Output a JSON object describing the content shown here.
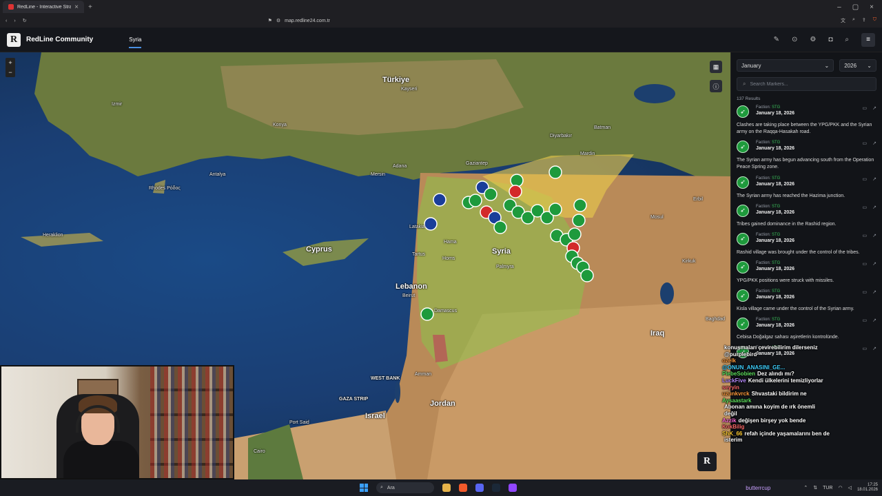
{
  "browser": {
    "tab_title": "RedLine - Interactive Strategic M",
    "url": "map.redline24.com.tr"
  },
  "header": {
    "logo_letter": "R",
    "brand": "RedLine Community",
    "nav_active": "Syria",
    "menu_icon": "hamburger-icon"
  },
  "map": {
    "zoom_in": "+",
    "zoom_out": "−",
    "labels": {
      "turkiye": "Türkiye",
      "syria": "Syria",
      "cyprus": "Cyprus",
      "lebanon": "Lebanon",
      "iraq": "Iraq",
      "jordan": "Jordan",
      "israel": "Israel",
      "west_bank": "WEST BANK",
      "gaza": "GAZA STRIP",
      "kayseri": "Kayseri",
      "adana": "Adana",
      "mersin": "Mersin",
      "gaziantep": "Gaziantep",
      "homs": "Homs",
      "hama": "Hama",
      "damascus": "Damascus",
      "beirut": "Beirut",
      "amman": "Amman",
      "baghdad": "Baghdad",
      "mosul": "Mosul",
      "erbil": "Erbil",
      "izmir": "Izmir",
      "konya": "Konya",
      "antalya": "Antalya",
      "rhodes": "Rhodes\nΡόδος",
      "heraklion": "Heraklion",
      "cairo": "Cairo",
      "port_said": "Port Said",
      "batman": "Batman",
      "mardin": "Mardin",
      "diyarbakir": "Diyarbakır",
      "palmyra": "Palmyra",
      "tartus": "Tartus",
      "latakia": "Latakia",
      "kirkuk": "Kirkuk"
    },
    "r_button": "R"
  },
  "sidebar": {
    "month": "January",
    "year": "2026",
    "search_placeholder": "Search Markers...",
    "results": "137 Results",
    "faction_label": "Faction:",
    "items": [
      {
        "faction": "STG",
        "date": "January 18, 2026",
        "text": "Clashes are taking place between the YPG/PKK and the Syrian army on the Raqqa-Hasakah road."
      },
      {
        "faction": "STG",
        "date": "January 18, 2026",
        "text": "The Syrian army has begun advancing south from the Operation Peace Spring zone."
      },
      {
        "faction": "STG",
        "date": "January 18, 2026",
        "text": "The Syrian army has reached the Hazima junction."
      },
      {
        "faction": "STG",
        "date": "January 18, 2026",
        "text": "Tribes gained dominance in the Rashid region."
      },
      {
        "faction": "STG",
        "date": "January 18, 2026",
        "text": "Rashid village was brought under the control of the tribes."
      },
      {
        "faction": "STG",
        "date": "January 18, 2026",
        "text": "YPG/PKK positions were struck with missiles."
      },
      {
        "faction": "STG",
        "date": "January 18, 2026",
        "text": "Kisla village came under the control of the Syrian army."
      },
      {
        "faction": "STG",
        "date": "January 18, 2026",
        "text": "Cebisa Doğalgaz sahası aşiretlerin kontrolünde."
      },
      {
        "faction": "STG",
        "date": "January 18, 2026",
        "text": ""
      }
    ]
  },
  "chat": [
    {
      "user": "",
      "msg": "konuşmaları çevirebilirim dilerseniz",
      "color": "#ffffff"
    },
    {
      "user": "",
      "msg": "@purplebird",
      "color": "#ffffff"
    },
    {
      "user": "ozelk",
      "msg": "",
      "color": "#ff9a3c"
    },
    {
      "user": "@ONUN_ANASINI_GE...",
      "msg": "",
      "color": "#3fd0ff"
    },
    {
      "user": "PlebeSobien",
      "msg": "Dez alındı mı?",
      "color": "#5fe05f"
    },
    {
      "user": "LuckFive",
      "msg": "Kendi ülkelerini temizliyorlar",
      "color": "#b88cff"
    },
    {
      "user": "seyyin",
      "msg": "",
      "color": "#ff6b6b"
    },
    {
      "user": "uzunkvrck",
      "msg": "Shvastaki bildirim ne",
      "color": "#ff9a3c"
    },
    {
      "user": "Aysaastark",
      "msg": "",
      "color": "#5fe05f"
    },
    {
      "user": "",
      "msg": "Abonan amına koyim de ırk önemli",
      "color": "#ffffff"
    },
    {
      "user": "",
      "msg": "değil",
      "color": "#ffffff"
    },
    {
      "user": "Azzik",
      "msg": "değişen birşey yok bende",
      "color": "#ff6bd6"
    },
    {
      "user": "KokBilig",
      "msg": "",
      "color": "#ff6b6b"
    },
    {
      "user": "ShK_66",
      "msg": "refah içinde yaşamalarını ben de",
      "color": "#ffcc33"
    },
    {
      "user": "",
      "msg": "isterim",
      "color": "#ffffff"
    }
  ],
  "taskbar": {
    "search": "Ara",
    "user": "butterrcup",
    "lang": "TUR",
    "time": "17:25",
    "date": "18.01.2026"
  },
  "colors": {
    "sdf_zone": "#d9c35a",
    "gov_zone": "#7fb84a",
    "marker_green": "#1e9a3c",
    "marker_red": "#d32a2a",
    "marker_blue": "#1a3e9a"
  }
}
